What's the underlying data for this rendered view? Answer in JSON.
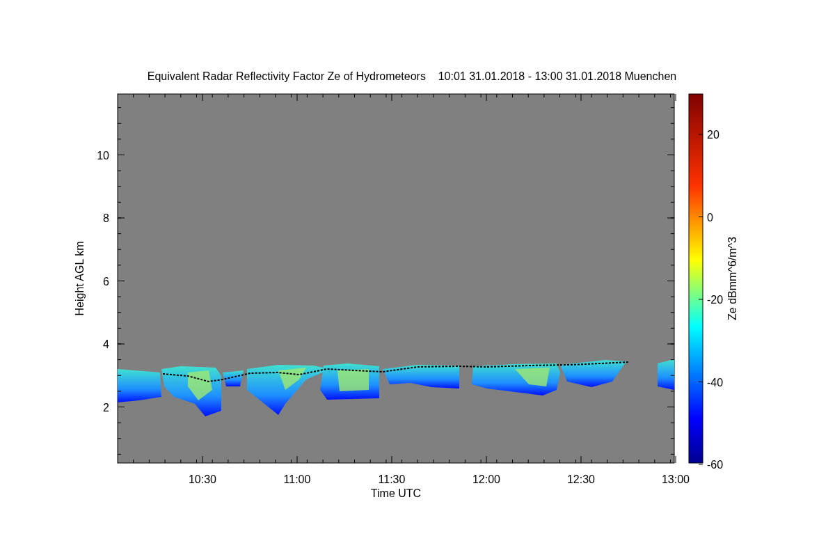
{
  "title": "Equivalent Radar Reflectivity Factor Ze of Hydrometeors    10:01 31.01.2018 - 13:00 31.01.2018 Muenchen",
  "y_axis": {
    "label": "Height AGL km",
    "ticks": [
      "10",
      "8",
      "6",
      "4",
      "2"
    ]
  },
  "x_axis": {
    "label": "Time UTC",
    "ticks": [
      "10:30",
      "11:00",
      "11:30",
      "12:00",
      "12:30",
      "13:00"
    ]
  },
  "colorbar": {
    "label": "Ze dBmm^6/m^3",
    "ticks": [
      "20",
      "0",
      "-20",
      "-40",
      "-60"
    ]
  }
}
